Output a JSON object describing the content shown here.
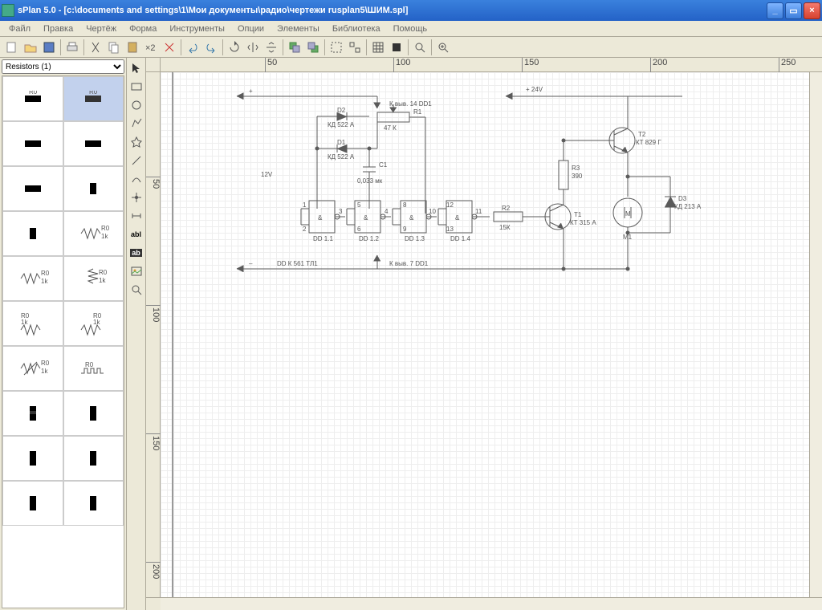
{
  "title": "sPlan 5.0 - [c:\\documents and settings\\1\\Мои документы\\радио\\чертежи rusplan5\\ШИМ.spl]",
  "menu": [
    "Файл",
    "Правка",
    "Чертёж",
    "Форма",
    "Инструменты",
    "Опции",
    "Элементы",
    "Библиотека",
    "Помощь"
  ],
  "lib_sel": "Resistors (1)",
  "hruler": [
    "50",
    "100",
    "150",
    "200",
    "250"
  ],
  "vruler": [
    "50",
    "100",
    "150",
    "200"
  ],
  "sch": {
    "plus": "+",
    "minus": "–",
    "v24": "+ 24V",
    "v12": "12V",
    "top_label": "К выв. 14 DD1",
    "bot_label": "К выв. 7 DD1",
    "dd_note": "DD К 561 ТЛ1",
    "d1": "D1",
    "d2": "D2",
    "d_val": "КД 522 А",
    "r1": "R1",
    "r1_val": "47 К",
    "c1": "C1",
    "c1_val": "0,033 мк",
    "r2": "R2",
    "r2_val": "15К",
    "r3": "R3",
    "r3_val": "390",
    "t1": "T1",
    "t1_val": "КТ 315 А",
    "t2": "T2",
    "t2_val": "КТ 829 Г",
    "m1": "M1",
    "m_sym": "M",
    "d3": "D3",
    "d3_val": "КД 213 А",
    "gate": "&",
    "dd11": "DD 1.1",
    "dd12": "DD 1.2",
    "dd13": "DD 1.3",
    "dd14": "DD 1.4",
    "pins": {
      "p1": "1",
      "p2": "2",
      "p3": "3",
      "p4": "4",
      "p5": "5",
      "p6": "6",
      "p8": "8",
      "p9": "9",
      "p10": "10",
      "p11": "11",
      "p12": "12",
      "p13": "13"
    }
  }
}
